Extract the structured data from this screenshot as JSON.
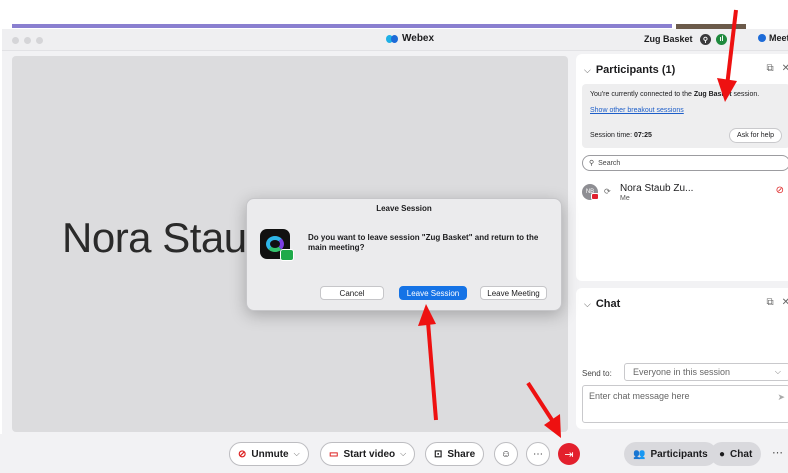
{
  "window": {
    "app_title": "Webex",
    "session_name": "Zug Basket",
    "meeting_info_label": "Meeting Info"
  },
  "stage": {
    "participant_display_name": "Nora Stau"
  },
  "participants_panel": {
    "title": "Participants (1)",
    "info_text_prefix": "You're currently connected to the ",
    "info_session": "Zug Basket",
    "info_text_suffix": " session.",
    "other_sessions_link": "Show other breakout sessions",
    "session_time_label": "Session time: ",
    "session_time_value": "07:25",
    "ask_for_help_label": "Ask for help",
    "search_placeholder": "Search",
    "participant": {
      "initials": "NB",
      "name": "Nora Staub Zu...",
      "role": "Me"
    }
  },
  "chat_panel": {
    "title": "Chat",
    "send_to_label": "Send to:",
    "send_to_value": "Everyone in this session",
    "message_placeholder": "Enter chat message here"
  },
  "toolbar": {
    "unmute_label": "Unmute",
    "start_video_label": "Start video",
    "share_label": "Share",
    "participants_label": "Participants",
    "chat_label": "Chat"
  },
  "dialog": {
    "title": "Leave Session",
    "message": "Do you want to leave session \"Zug Basket\" and return to the main meeting?",
    "cancel_label": "Cancel",
    "leave_session_label": "Leave Session",
    "leave_meeting_label": "Leave Meeting"
  },
  "colors": {
    "leave_red": "#e3202d",
    "primary_blue": "#1573e6",
    "annotation_arrow": "#ee1111"
  }
}
